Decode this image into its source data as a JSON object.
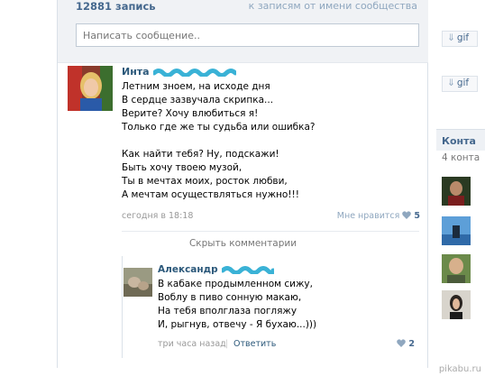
{
  "wall": {
    "posts_count": "12881 запись",
    "community_link": "к записям от имени сообщества",
    "compose_placeholder": "Написать сообщение.."
  },
  "post": {
    "author": "Инта",
    "stanza1": [
      "Летним зноем, на исходе дня",
      "В сердце зазвучала скрипка...",
      "Верите? Хочу влюбиться я!",
      "Только где же ты судьба или ошибка?"
    ],
    "stanza2": [
      "Как найти тебя? Ну, подскажи!",
      "Быть хочу твоею музой,",
      "Ты в мечтах моих, росток любви,",
      "А мечтам осуществляться нужно!!!"
    ],
    "date": "сегодня в 18:18",
    "like_label": "Мне нравится",
    "like_count": "5"
  },
  "hide_comments": "Скрыть комментарии",
  "comment": {
    "author": "Александр",
    "lines": [
      "В кабаке продымленном сижу,",
      "Воблу в пиво сонную макаю,",
      "На тебя вполглаза погляжу",
      "И, рыгнув, отвечу - Я бухаю...)))"
    ],
    "time": "три часа назад",
    "separator": "|",
    "reply": "Ответить",
    "like_count": "2"
  },
  "sidebar": {
    "gif_label": "gif",
    "contacts_title": "Конта",
    "contacts_count": "4 конта"
  },
  "watermark": "pikabu.ru",
  "colors": {
    "link": "#2b587a",
    "header_bg": "#f0f2f5",
    "like_heart": "#8fa7bf",
    "scribble": "#3ab2d6"
  }
}
